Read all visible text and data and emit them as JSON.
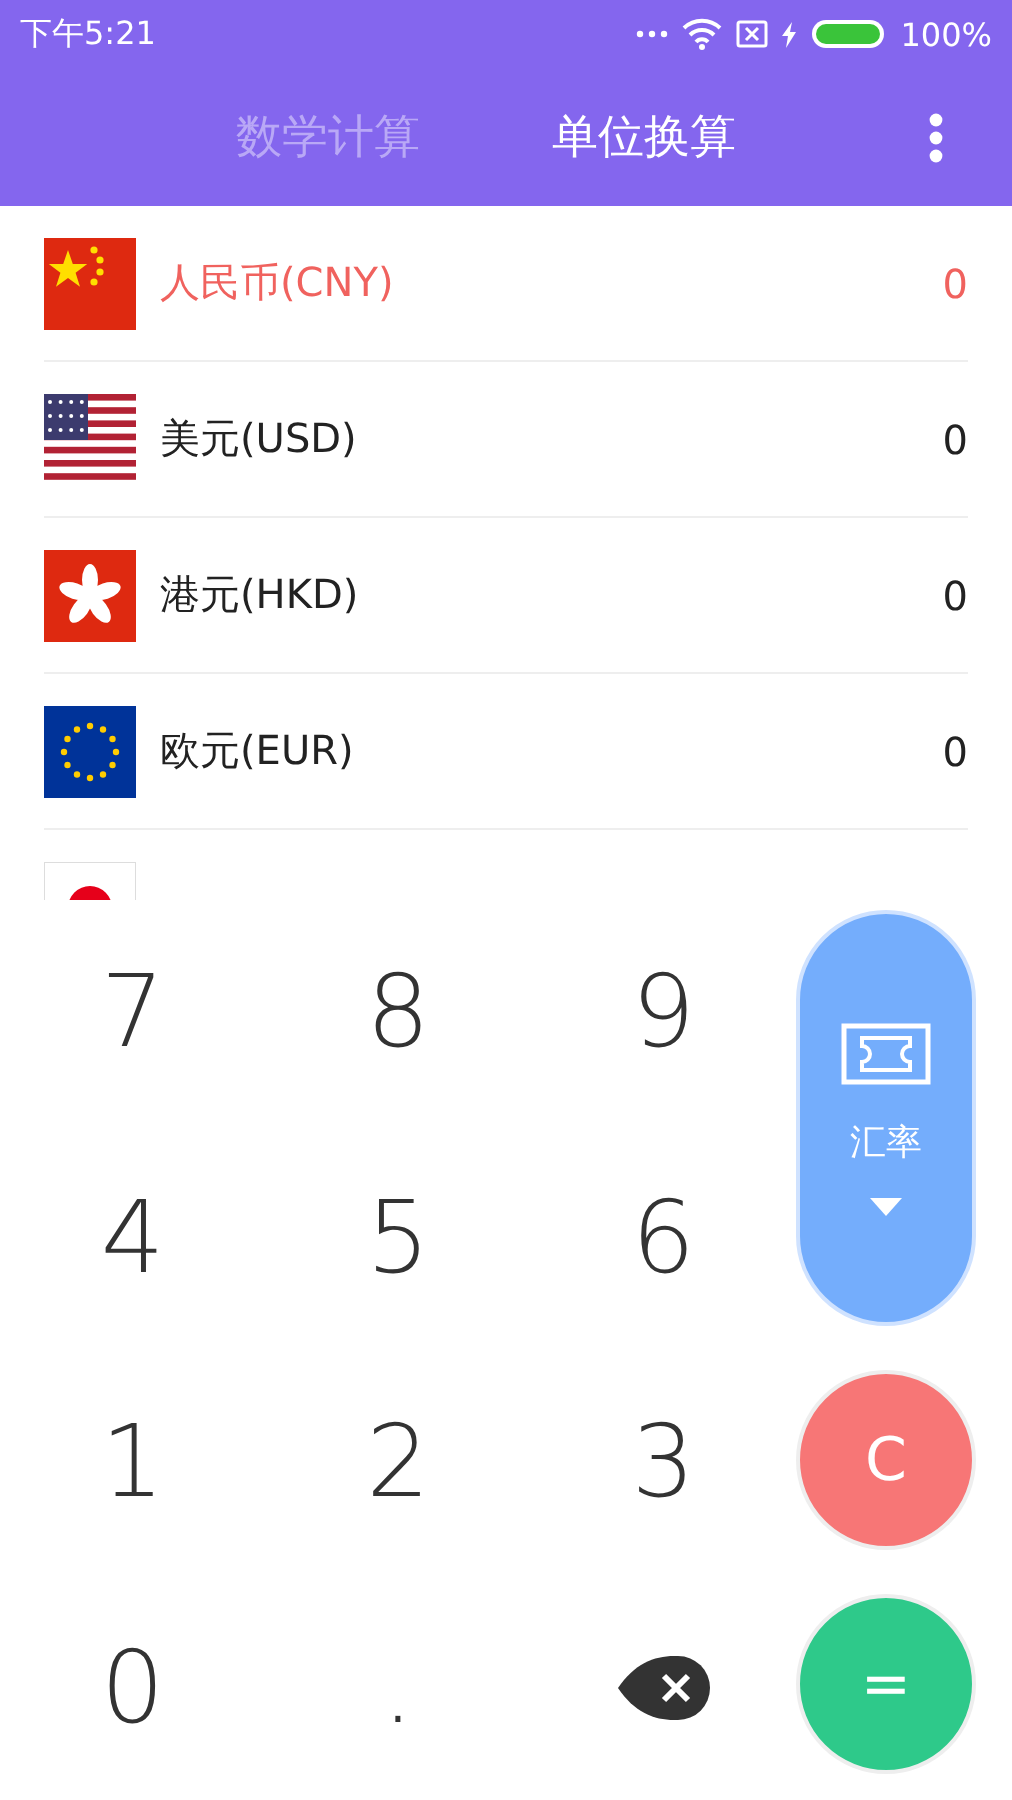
{
  "status_bar": {
    "time": "下午5:21",
    "battery": "100%"
  },
  "tabs": [
    {
      "label": "数学计算",
      "selected": false
    },
    {
      "label": "单位换算",
      "selected": true
    }
  ],
  "currencies": [
    {
      "kind": "cn",
      "name": "人民币(CNY)",
      "value": "0",
      "selected": true
    },
    {
      "kind": "us",
      "name": "美元(USD)",
      "value": "0",
      "selected": false
    },
    {
      "kind": "hk",
      "name": "港元(HKD)",
      "value": "0",
      "selected": false
    },
    {
      "kind": "eu",
      "name": "欧元(EUR)",
      "value": "0",
      "selected": false
    },
    {
      "kind": "jp"
    }
  ],
  "keys": [
    {
      "kind": "digit",
      "label": "7"
    },
    {
      "kind": "digit",
      "label": "8"
    },
    {
      "kind": "digit",
      "label": "9"
    },
    {
      "kind": "digit",
      "label": "4"
    },
    {
      "kind": "digit",
      "label": "5"
    },
    {
      "kind": "digit",
      "label": "6"
    },
    {
      "kind": "digit",
      "label": "1"
    },
    {
      "kind": "digit",
      "label": "2"
    },
    {
      "kind": "digit",
      "label": "3"
    },
    {
      "kind": "digit",
      "label": "0"
    },
    {
      "kind": "digit",
      "label": "."
    },
    {
      "kind": "backspace"
    }
  ],
  "rate_button": {
    "label": "汇率"
  },
  "clear_button": {
    "label": "C"
  },
  "equals_button": {
    "label": "="
  }
}
